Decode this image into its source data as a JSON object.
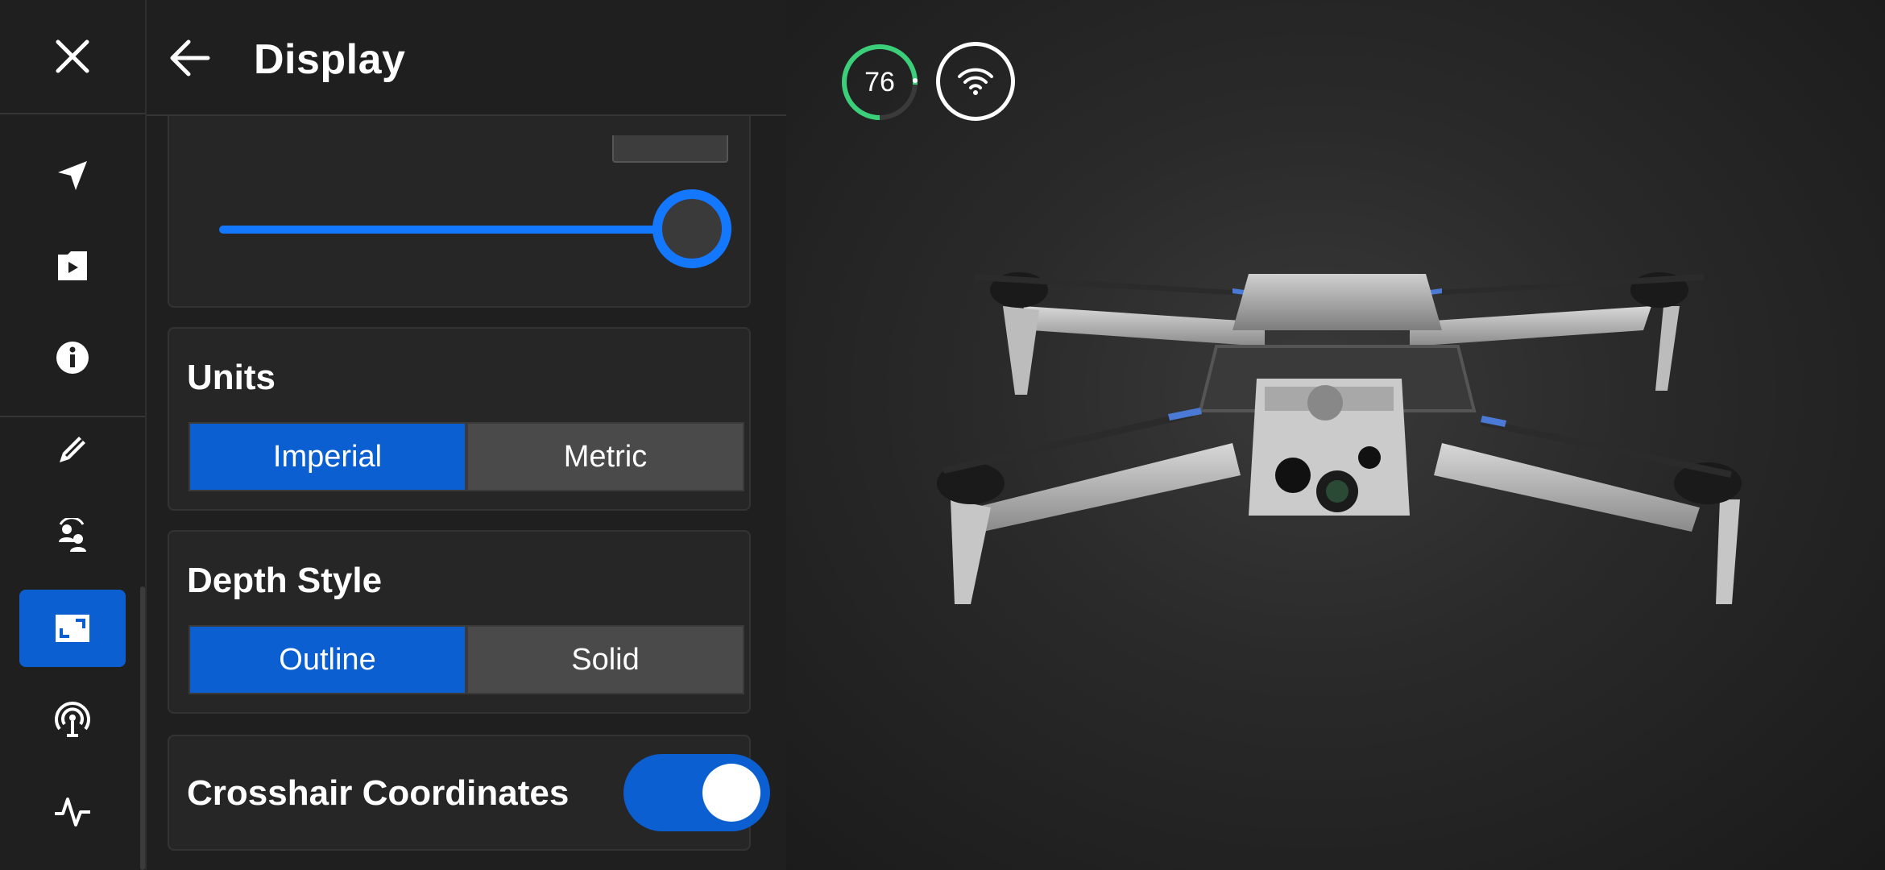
{
  "panel": {
    "title": "Display",
    "units": {
      "title": "Units",
      "options": [
        "Imperial",
        "Metric"
      ],
      "selected": "Imperial"
    },
    "depth_style": {
      "title": "Depth Style",
      "options": [
        "Outline",
        "Solid"
      ],
      "selected": "Outline"
    },
    "crosshair": {
      "label": "Crosshair Coordinates",
      "enabled": true
    },
    "slider": {
      "value_fraction": 1.0
    }
  },
  "rail": {
    "items": [
      "close-icon",
      "navigation-arrow-icon",
      "media-folder-icon",
      "info-icon",
      "pen-icon",
      "user-swap-icon",
      "display-icon",
      "broadcast-icon",
      "activity-icon"
    ],
    "active": "display-icon"
  },
  "status": {
    "battery_percent": "76",
    "battery_color": "#3ccf7a",
    "wifi_icon": "wifi-icon"
  },
  "colors": {
    "accent": "#0b5fd0",
    "slider": "#1478ff"
  }
}
